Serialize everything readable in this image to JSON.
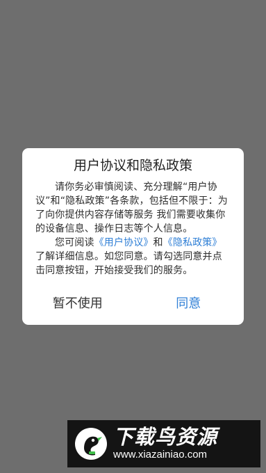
{
  "dialog": {
    "title": "用户协议和隐私政策",
    "paragraph1": "请你务必审慎阅读、充分理解“用户协议”和“隐私政策”各条款，包括但不限于：为了向你提供内容存储等服务 我们需要收集你的设备信息、操作日志等个人信息。",
    "paragraph2_prefix": "您可阅读",
    "user_agreement_link": "《用户协议》",
    "and_text": "和",
    "privacy_policy_link": "《隐私政策》",
    "paragraph2_suffix": "了解详细信息。如您同意。请勾选同意并点击同意按钮，开始接受我们的服务。",
    "cancel_label": "暂不使用",
    "agree_label": "同意"
  },
  "watermark": {
    "name": "下载鸟资源",
    "url": "www.xiazainiao.com"
  },
  "colors": {
    "overlay": "#6e6e6e",
    "link": "#2f7fd6",
    "watermark_bg": "#141414",
    "logo_green": "#3fbf4a"
  }
}
